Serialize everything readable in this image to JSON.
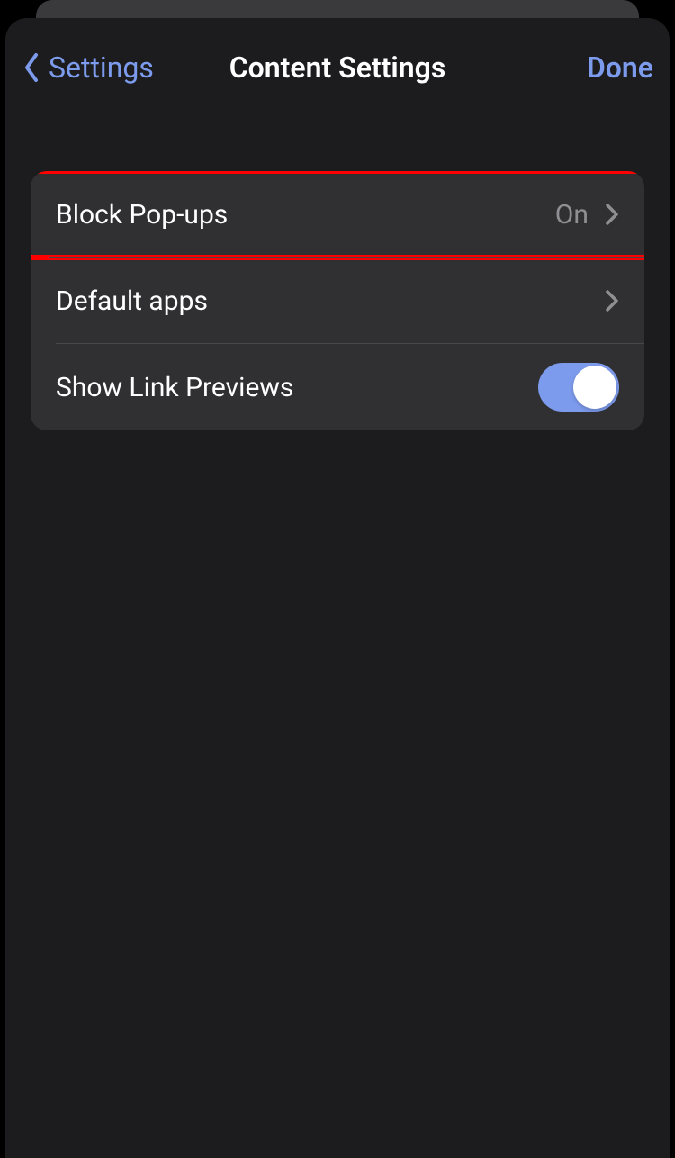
{
  "nav": {
    "back_label": "Settings",
    "title": "Content Settings",
    "done_label": "Done"
  },
  "rows": {
    "block_popups": {
      "label": "Block Pop-ups",
      "value": "On"
    },
    "default_apps": {
      "label": "Default apps"
    },
    "link_previews": {
      "label": "Show Link Previews",
      "toggle_on": true
    }
  }
}
